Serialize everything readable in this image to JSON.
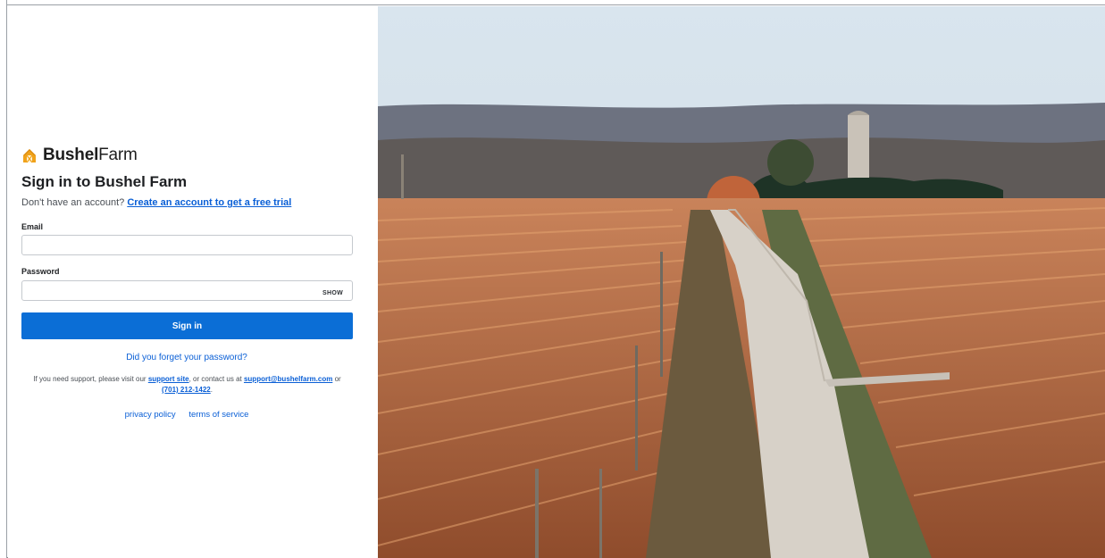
{
  "brand": {
    "name_bold": "Bushel",
    "name_light": "Farm",
    "icon": "bushel-barn-icon",
    "accent": "#f0a21b"
  },
  "signin": {
    "title": "Sign in to Bushel Farm",
    "no_account_text": "Don't have an account?",
    "create_account_link": "Create an account to get a free trial",
    "email_label": "Email",
    "email_value": "",
    "password_label": "Password",
    "password_value": "",
    "show_label": "SHOW",
    "submit_label": "Sign in",
    "forgot_link": "Did you forget your password?",
    "support_prefix": "If you need support, please visit our",
    "support_site_link": "support site",
    "support_mid": ", or contact us at",
    "support_email": "support@bushelfarm.com",
    "support_or": "or",
    "support_phone": "(701) 212-1422",
    "support_end": ".",
    "privacy_link": "privacy policy",
    "terms_link": "terms of service"
  },
  "colors": {
    "primary": "#0b6ed6",
    "link": "#0a5fd6"
  }
}
